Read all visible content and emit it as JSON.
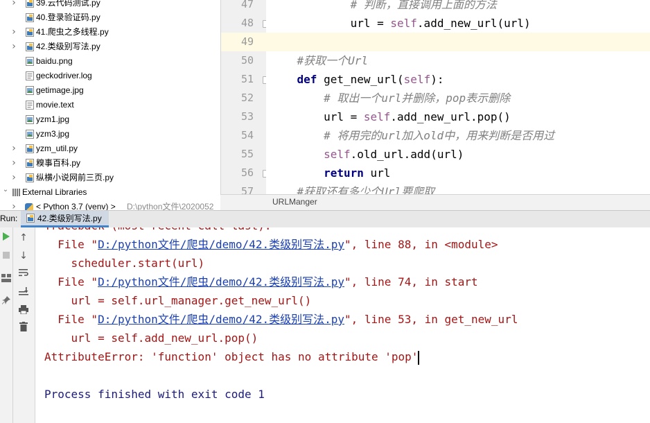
{
  "project_tree": {
    "items": [
      {
        "label": "39.云代码测试.py",
        "type": "py",
        "expandable": true
      },
      {
        "label": "40.登录验证码.py",
        "type": "py",
        "expandable": false
      },
      {
        "label": "41.爬虫之多线程.py",
        "type": "py",
        "expandable": true
      },
      {
        "label": "42.类级别写法.py",
        "type": "py",
        "expandable": true
      },
      {
        "label": "baidu.png",
        "type": "image",
        "expandable": false
      },
      {
        "label": "geckodriver.log",
        "type": "text",
        "expandable": false
      },
      {
        "label": "getimage.jpg",
        "type": "image",
        "expandable": false
      },
      {
        "label": "movie.text",
        "type": "text",
        "expandable": false
      },
      {
        "label": "yzm1.jpg",
        "type": "image",
        "expandable": false
      },
      {
        "label": "yzm3.jpg",
        "type": "image",
        "expandable": false
      },
      {
        "label": "yzm_util.py",
        "type": "py",
        "expandable": true
      },
      {
        "label": "糗事百科.py",
        "type": "py",
        "expandable": true
      },
      {
        "label": "纵横小说网前三页.py",
        "type": "py",
        "expandable": true
      }
    ],
    "external_libraries": "External Libraries",
    "python_sdk": "< Python 3.7 (venv) >",
    "python_sdk_path": "D:\\python文件\\2020052"
  },
  "editor": {
    "line_numbers": [
      "47",
      "48",
      "49",
      "50",
      "51",
      "52",
      "53",
      "54",
      "55",
      "56",
      "57"
    ],
    "lines": [
      {
        "indent": "            ",
        "parts": [
          {
            "t": "# 判断，直接调用上面的方法",
            "c": "cmt"
          }
        ]
      },
      {
        "indent": "            ",
        "parts": [
          {
            "t": "url = ",
            "c": ""
          },
          {
            "t": "self",
            "c": "self"
          },
          {
            "t": ".add_new_url(url)",
            "c": ""
          }
        ]
      },
      {
        "indent": "",
        "parts": []
      },
      {
        "indent": "    ",
        "parts": [
          {
            "t": "#获取一个Url",
            "c": "cmt"
          }
        ]
      },
      {
        "indent": "    ",
        "parts": [
          {
            "t": "def",
            "c": "kw"
          },
          {
            "t": " get_new_url(",
            "c": ""
          },
          {
            "t": "self",
            "c": "self"
          },
          {
            "t": "):",
            "c": ""
          }
        ]
      },
      {
        "indent": "        ",
        "parts": [
          {
            "t": "# 取出一个url并删除，pop表示删除",
            "c": "cmt"
          }
        ]
      },
      {
        "indent": "        ",
        "parts": [
          {
            "t": "url = ",
            "c": ""
          },
          {
            "t": "self",
            "c": "self"
          },
          {
            "t": ".add_new_url.pop()",
            "c": ""
          }
        ]
      },
      {
        "indent": "        ",
        "parts": [
          {
            "t": "# 将用完的url加入old中，用来判断是否用过",
            "c": "cmt"
          }
        ]
      },
      {
        "indent": "        ",
        "parts": [
          {
            "t": "self",
            "c": "self"
          },
          {
            "t": ".old_url.add(url)",
            "c": ""
          }
        ]
      },
      {
        "indent": "        ",
        "parts": [
          {
            "t": "return",
            "c": "kw"
          },
          {
            "t": " url",
            "c": ""
          }
        ]
      },
      {
        "indent": "    ",
        "parts": [
          {
            "t": "#获取还有多少个Url要爬取",
            "c": "cmt"
          }
        ]
      }
    ],
    "highlighted_line": "49",
    "breadcrumb": "URLManger"
  },
  "run_window": {
    "label": "Run:",
    "tab_label": "42.类级别写法.py",
    "console": [
      {
        "indent": "",
        "parts": [
          {
            "t": "Traceback (most recent call last):",
            "c": ""
          }
        ]
      },
      {
        "indent": "  ",
        "parts": [
          {
            "t": "File \"",
            "c": ""
          },
          {
            "t": "D:/python文件/爬虫/demo/42.类级别写法.py",
            "c": "clink"
          },
          {
            "t": "\", line 88, in <module>",
            "c": ""
          }
        ]
      },
      {
        "indent": "    ",
        "parts": [
          {
            "t": "scheduler.start(url)",
            "c": ""
          }
        ]
      },
      {
        "indent": "  ",
        "parts": [
          {
            "t": "File \"",
            "c": ""
          },
          {
            "t": "D:/python文件/爬虫/demo/42.类级别写法.py",
            "c": "clink"
          },
          {
            "t": "\", line 74, in start",
            "c": ""
          }
        ]
      },
      {
        "indent": "    ",
        "parts": [
          {
            "t": "url = self.url_manager.get_new_url()",
            "c": ""
          }
        ]
      },
      {
        "indent": "  ",
        "parts": [
          {
            "t": "File \"",
            "c": ""
          },
          {
            "t": "D:/python文件/爬虫/demo/42.类级别写法.py",
            "c": "clink"
          },
          {
            "t": "\", line 53, in get_new_url",
            "c": ""
          }
        ]
      },
      {
        "indent": "    ",
        "parts": [
          {
            "t": "url = self.add_new_url.pop()",
            "c": ""
          }
        ]
      },
      {
        "indent": "",
        "parts": [
          {
            "t": "AttributeError: 'function' object has no attribute 'pop'",
            "c": ""
          }
        ]
      },
      {
        "indent": "",
        "parts": []
      },
      {
        "indent": "",
        "parts": [
          {
            "t": "Process finished with exit code 1",
            "c": "cnormal"
          }
        ]
      }
    ],
    "toolbar_icons": [
      "rerun-icon",
      "stop-icon",
      "layout-icon",
      "pin-icon",
      "up-arrow-icon",
      "down-arrow-icon",
      "soft-wrap-icon",
      "scroll-to-end-icon",
      "print-icon",
      "trash-icon"
    ]
  },
  "colors": {
    "keyword": "#000080",
    "self": "#94558d",
    "comment": "#808080",
    "error_text": "#a31515",
    "link": "#1a3fb0",
    "current_line": "#fffae3"
  }
}
